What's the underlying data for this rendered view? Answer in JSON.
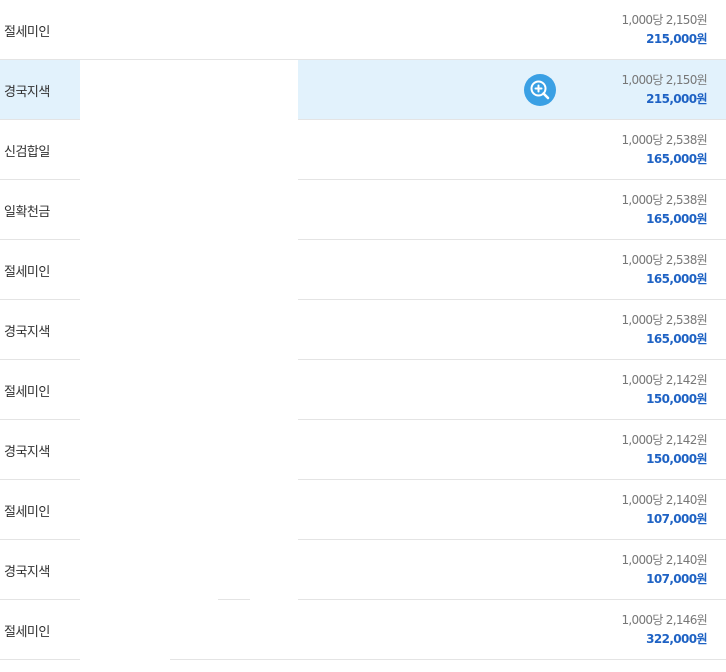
{
  "products": [
    {
      "name": "절세미인",
      "unit_price": "1,000당 2,150원",
      "total": "215,000원",
      "highlighted": false
    },
    {
      "name": "경국지색",
      "unit_price": "1,000당 2,150원",
      "total": "215,000원",
      "highlighted": true
    },
    {
      "name": "신검합일",
      "unit_price": "1,000당 2,538원",
      "total": "165,000원",
      "highlighted": false
    },
    {
      "name": "일확천금",
      "unit_price": "1,000당 2,538원",
      "total": "165,000원",
      "highlighted": false
    },
    {
      "name": "절세미인",
      "unit_price": "1,000당 2,538원",
      "total": "165,000원",
      "highlighted": false
    },
    {
      "name": "경국지색",
      "unit_price": "1,000당 2,538원",
      "total": "165,000원",
      "highlighted": false
    },
    {
      "name": "절세미인",
      "unit_price": "1,000당 2,142원",
      "total": "150,000원",
      "highlighted": false
    },
    {
      "name": "경국지색",
      "unit_price": "1,000당 2,142원",
      "total": "150,000원",
      "highlighted": false
    },
    {
      "name": "절세미인",
      "unit_price": "1,000당 2,140원",
      "total": "107,000원",
      "highlighted": false
    },
    {
      "name": "경국지색",
      "unit_price": "1,000당 2,140원",
      "total": "107,000원",
      "highlighted": false
    },
    {
      "name": "절세미인",
      "unit_price": "1,000당 2,146원",
      "total": "322,000원",
      "highlighted": false
    }
  ],
  "zoom_icon": "zoom-in-icon",
  "colors": {
    "highlight_bg": "#e2f2fc",
    "total_text": "#1e62c4",
    "zoom_button": "#3aa0e4"
  }
}
